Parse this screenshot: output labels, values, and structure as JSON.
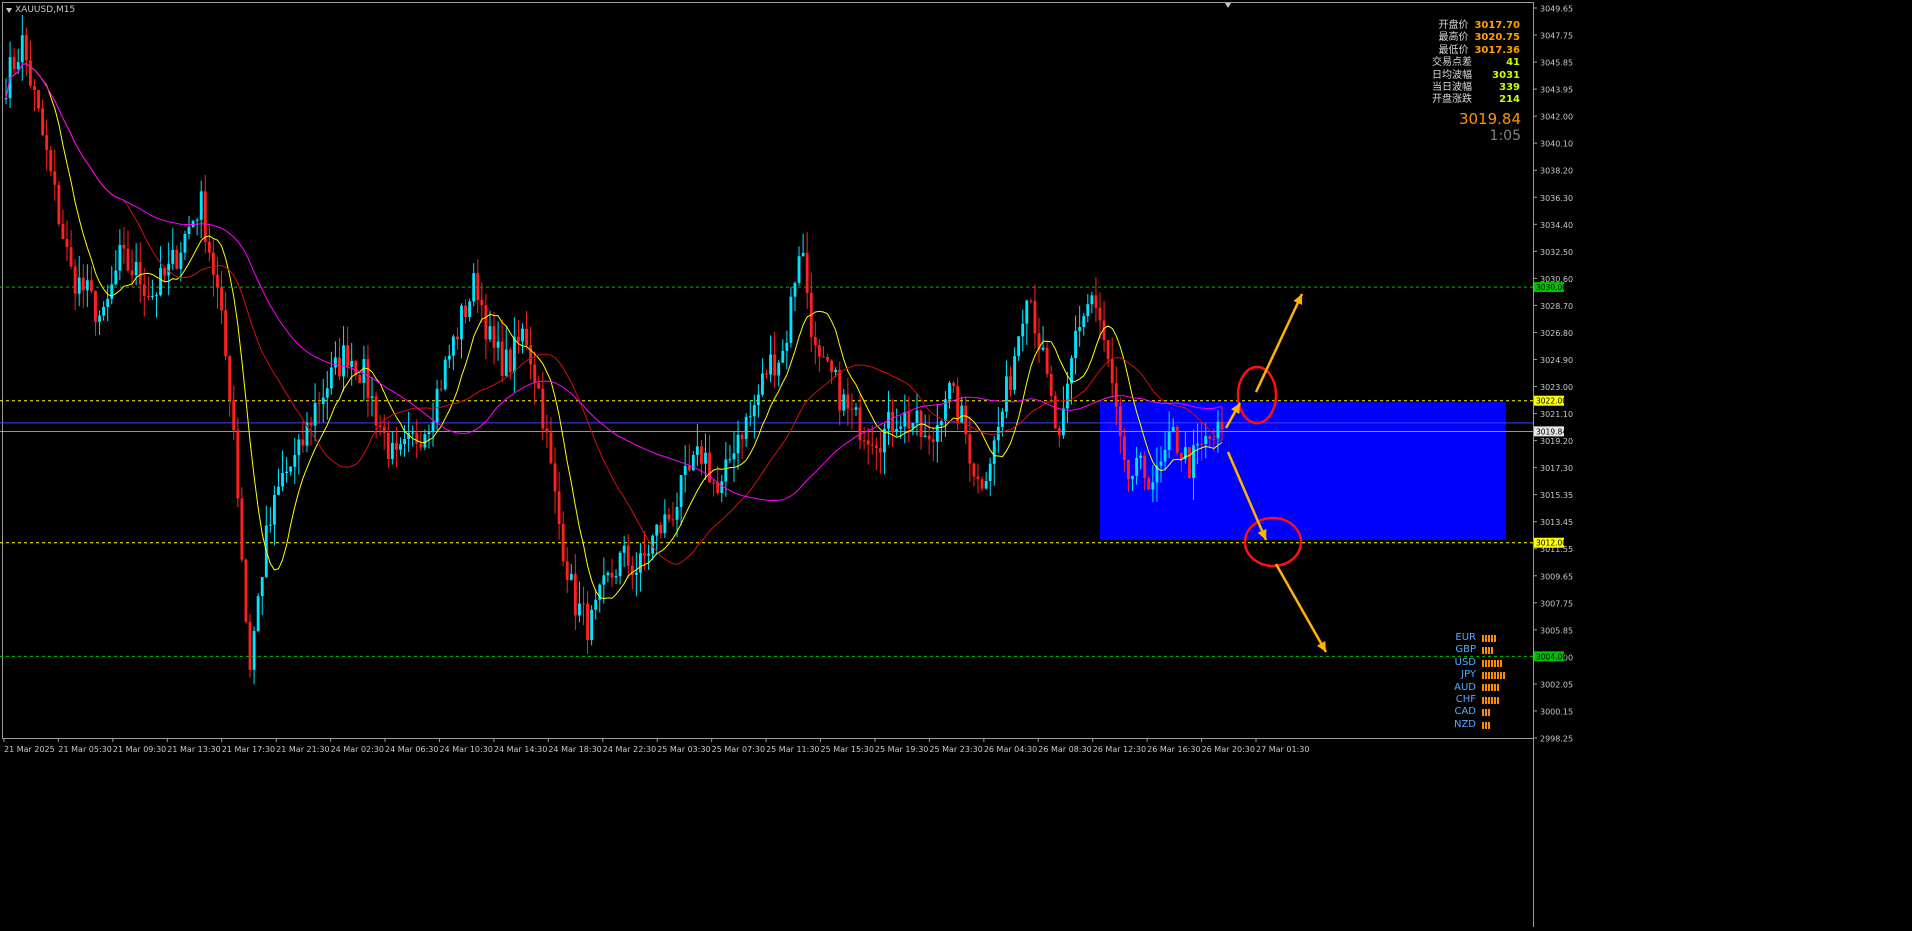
{
  "window": {
    "title": "XAUUSD,M15"
  },
  "info_panel": [
    {
      "label": "开盘价",
      "value": "3017.70",
      "color": "#ffa000"
    },
    {
      "label": "最高价",
      "value": "3020.75",
      "color": "#ffa000"
    },
    {
      "label": "最低价",
      "value": "3017.36",
      "color": "#ffa000"
    },
    {
      "label": "交易点差",
      "value": "41",
      "color": "#c8ff00"
    },
    {
      "label": "日均波幅",
      "value": "3031",
      "color": "#c8ff00"
    },
    {
      "label": "当日波幅",
      "value": "339",
      "color": "#c8ff00"
    },
    {
      "label": "开盘涨跌",
      "value": "214",
      "color": "#c8ff00"
    }
  ],
  "current_price": "3019.84",
  "bar_timer": "1:05",
  "currency_strength": [
    {
      "code": "EUR",
      "bars": 5
    },
    {
      "code": "GBP",
      "bars": 4
    },
    {
      "code": "USD",
      "bars": 7
    },
    {
      "code": "JPY",
      "bars": 8
    },
    {
      "code": "AUD",
      "bars": 6
    },
    {
      "code": "CHF",
      "bars": 6
    },
    {
      "code": "CAD",
      "bars": 3
    },
    {
      "code": "NZD",
      "bars": 3
    }
  ],
  "colors": {
    "background": "#000000",
    "bull": "#00e5ff",
    "bear": "#ff2020",
    "ma_fast": "#ffff00",
    "ma_mid": "#d01010",
    "ma_slow": "#ff00ff",
    "zone": "#0000ff",
    "arrow": "#ffb400",
    "circle": "#ff1010",
    "level_green": "#00c000",
    "level_yellow": "#ffff00",
    "price_line": "#4040ff"
  },
  "chart_data": {
    "type": "candlestick",
    "symbol": "XAUUSD",
    "timeframe": "M15",
    "ylim": [
      2998.25,
      3049.65
    ],
    "y_ticks": [
      "3049.65",
      "3047.75",
      "3045.85",
      "3043.95",
      "3042.00",
      "3040.10",
      "3038.20",
      "3036.30",
      "3034.40",
      "3032.50",
      "3030.60",
      "3028.70",
      "3026.80",
      "3024.90",
      "3023.00",
      "3021.10",
      "3019.20",
      "3017.30",
      "3015.35",
      "3013.45",
      "3011.55",
      "3009.65",
      "3007.75",
      "3005.85",
      "3004.00",
      "3002.05",
      "3000.15",
      "2998.25"
    ],
    "x_ticks": [
      "21 Mar 2025",
      "21 Mar 05:30",
      "21 Mar 09:30",
      "21 Mar 13:30",
      "21 Mar 17:30",
      "21 Mar 21:30",
      "24 Mar 02:30",
      "24 Mar 06:30",
      "24 Mar 10:30",
      "24 Mar 14:30",
      "24 Mar 18:30",
      "24 Mar 22:30",
      "25 Mar 03:30",
      "25 Mar 07:30",
      "25 Mar 11:30",
      "25 Mar 15:30",
      "25 Mar 19:30",
      "25 Mar 23:30",
      "26 Mar 04:30",
      "26 Mar 08:30",
      "26 Mar 12:30",
      "26 Mar 16:30",
      "26 Mar 20:30",
      "27 Mar 01:30"
    ],
    "close_path": [
      3044.5,
      3047.2,
      3042.0,
      3036.5,
      3031.0,
      3029.5,
      3027.5,
      3032.0,
      3031.0,
      3029.5,
      3031.0,
      3033.5,
      3036.0,
      3030.0,
      3021.0,
      3003.0,
      3012.0,
      3016.5,
      3018.0,
      3021.5,
      3023.5,
      3025.5,
      3024.0,
      3020.5,
      3017.5,
      3019.0,
      3020.5,
      3024.0,
      3027.5,
      3030.5,
      3025.5,
      3024.5,
      3027.0,
      3022.0,
      3014.0,
      3008.0,
      3006.0,
      3009.0,
      3011.0,
      3010.0,
      3012.5,
      3014.0,
      3016.5,
      3018.5,
      3015.0,
      3019.5,
      3021.0,
      3024.5,
      3025.5,
      3033.5,
      3024.5,
      3023.5,
      3021.0,
      3020.0,
      3019.5,
      3021.0,
      3020.5,
      3018.5,
      3023.0,
      3020.5,
      3016.0,
      3019.0,
      3024.0,
      3030.5,
      3024.5,
      3018.5,
      3027.0,
      3029.5,
      3024.5,
      3016.5,
      3017.0,
      3016.5,
      3019.5,
      3017.5,
      3019.0,
      3019.84
    ],
    "levels": [
      {
        "price": 3030.0,
        "label": "3030.00",
        "style": "green"
      },
      {
        "price": 3022.0,
        "label": "3022.00",
        "style": "yellow"
      },
      {
        "price": 3012.0,
        "label": "3012.00",
        "style": "yellow"
      },
      {
        "price": 3004.0,
        "label": "3004.00",
        "style": "green"
      }
    ],
    "current_price": 3019.84,
    "zone": {
      "price_top": 3021.9,
      "price_bottom": 3012.2,
      "from_label": "26 Mar 12:30"
    },
    "annotations": [
      "breakout-up-arrow",
      "breakout-up-circle",
      "breakdown-arrow",
      "breakdown-circle"
    ]
  }
}
